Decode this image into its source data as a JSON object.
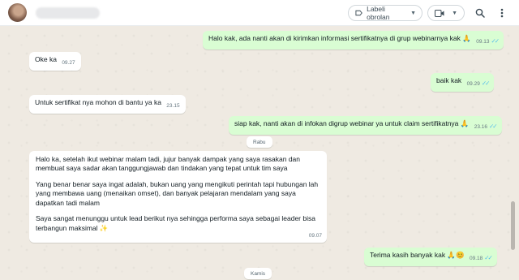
{
  "header": {
    "label_button": "Labeli obrolan",
    "icons": {
      "label": "label-tag-icon",
      "label_chevron": "chevron-down-icon",
      "video": "video-camera-icon",
      "video_chevron": "chevron-down-icon",
      "search": "search-icon",
      "menu": "more-vertical-icon"
    }
  },
  "messages": [
    {
      "dir": "out",
      "text": "Halo kak, ada nanti akan di kirimkan informasi sertifikatnya di grup webinarnya kak 🙏",
      "time": "09.13"
    },
    {
      "dir": "in",
      "text": "Oke ka",
      "time": "09.27"
    },
    {
      "dir": "out",
      "text": "baik kak",
      "time": "09.29"
    },
    {
      "dir": "in",
      "text": "Untuk sertifikat nya mohon di bantu ya ka",
      "time": "23.15"
    },
    {
      "dir": "out",
      "text": "siap kak, nanti akan di infokan digrup webinar ya untuk claim sertifikatnya 🙏",
      "time": "23.16"
    },
    {
      "dir": "in",
      "paragraphs": [
        "Halo ka, setelah ikut webinar malam tadi, jujur banyak dampak yang saya rasakan dan membuat saya sadar akan tanggungjawab dan tindakan yang tepat untuk tim saya",
        "Yang benar benar saya ingat adalah, bukan uang yang mengikuti perintah tapi hubungan lah yang membawa uang (menaikan omset), dan banyak pelajaran mendalam yang saya dapatkan tadi malam",
        "Saya sangat menunggu untuk lead berikut nya sehingga performa saya sebagai leader bisa terbangun maksimal ✨"
      ],
      "time": "09.07"
    },
    {
      "dir": "out",
      "text": "Terima kasih banyak kak 🙏😊",
      "time": "09.18"
    }
  ],
  "day_separators": [
    "Rabu",
    "Kamis"
  ],
  "read_ticks": "✓✓",
  "colors": {
    "incoming": "#ffffff",
    "outgoing": "#d9fdd3",
    "wallpaper": "#efeae2",
    "read_ticks": "#53bdeb"
  }
}
